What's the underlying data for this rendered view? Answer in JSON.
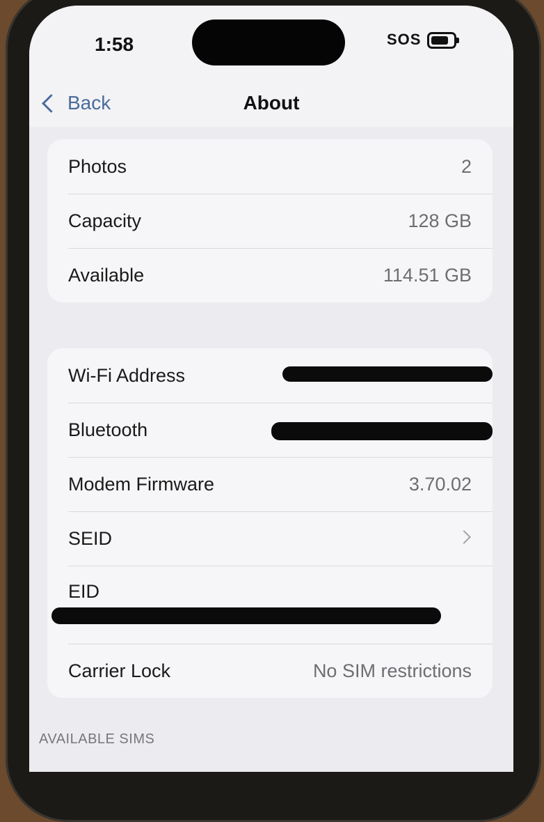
{
  "status_bar": {
    "time": "1:58",
    "signal_text": "SOS",
    "battery_icon": "battery-icon"
  },
  "nav": {
    "back_label": "Back",
    "title": "About"
  },
  "storage_group": [
    {
      "label": "Photos",
      "value": "2"
    },
    {
      "label": "Capacity",
      "value": "128 GB"
    },
    {
      "label": "Available",
      "value": "114.51 GB"
    }
  ],
  "network_group": {
    "wifi_label": "Wi-Fi Address",
    "bluetooth_label": "Bluetooth",
    "modem_label": "Modem Firmware",
    "modem_value": "3.70.02",
    "seid_label": "SEID",
    "eid_label": "EID",
    "carrier_lock_label": "Carrier Lock",
    "carrier_lock_value": "No SIM restrictions"
  },
  "section_header": "AVAILABLE SIMS"
}
